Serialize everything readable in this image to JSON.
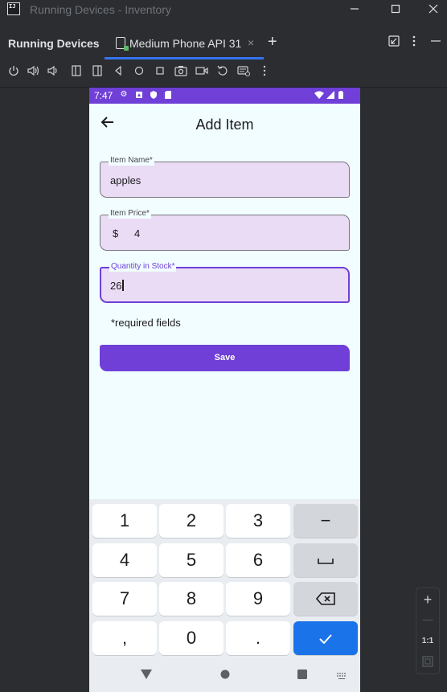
{
  "window": {
    "title": "Running Devices - Inventory",
    "logo_text": "IJ",
    "controls": [
      "minimize",
      "maximize",
      "close"
    ]
  },
  "tabs": {
    "panel_title": "Running Devices",
    "active_tab": "Medium Phone API 31",
    "close_glyph": "×",
    "add_glyph": "+"
  },
  "toolbar": {
    "icons": [
      "power-icon",
      "volume-up-icon",
      "volume-down-icon",
      "rotate-left-icon",
      "rotate-right-icon",
      "back-icon",
      "home-icon",
      "overview-icon",
      "camera-icon",
      "record-icon",
      "reset-icon",
      "keyboard-icon",
      "more-icon"
    ]
  },
  "phone": {
    "status_time": "7:47",
    "app_title": "Add Item",
    "fields": [
      {
        "label": "Item Name*",
        "value": "apples"
      },
      {
        "label": "Item Price*",
        "prefix": "$",
        "value": "4"
      },
      {
        "label": "Quantity in Stock*",
        "value": "26"
      }
    ],
    "required_note": "*required fields",
    "save_label": "Save"
  },
  "keyboard": {
    "rows": [
      [
        "1",
        "2",
        "3",
        "−"
      ],
      [
        "4",
        "5",
        "6",
        "␣"
      ],
      [
        "7",
        "8",
        "9",
        "⌫"
      ],
      [
        ",",
        "0",
        ".",
        "✓"
      ]
    ]
  },
  "zoom": {
    "in": "+",
    "out": "—",
    "actual": "1:1"
  },
  "colors": {
    "accent": "#6f3fd7",
    "field_bg": "#eadcf5",
    "done_key": "#1a73e8",
    "ide_bg": "#2b2d30",
    "ide_tab_underline": "#3574f0"
  }
}
